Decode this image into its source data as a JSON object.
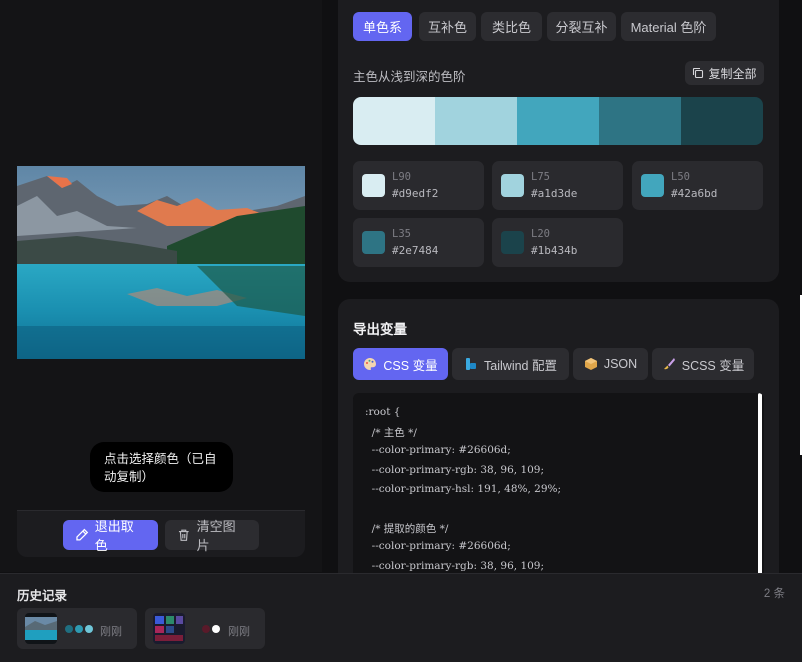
{
  "scheme_tabs": [
    {
      "label": "单色系",
      "active": true
    },
    {
      "label": "互补色",
      "active": false
    },
    {
      "label": "类比色",
      "active": false
    },
    {
      "label": "分裂互补",
      "active": false
    },
    {
      "label": "Material 色阶",
      "active": false
    }
  ],
  "scale_section": {
    "label": "主色从浅到深的色阶",
    "copy_all_label": "复制全部",
    "swatches": [
      {
        "level": "L90",
        "hex": "#d9edf2"
      },
      {
        "level": "L75",
        "hex": "#a1d3de"
      },
      {
        "level": "L50",
        "hex": "#42a6bd"
      },
      {
        "level": "L35",
        "hex": "#2e7484"
      },
      {
        "level": "L20",
        "hex": "#1b434b"
      }
    ]
  },
  "export": {
    "title": "导出变量",
    "tabs": [
      {
        "label": "CSS 变量",
        "icon": "palette-icon",
        "active": true
      },
      {
        "label": "Tailwind 配置",
        "icon": "tailwind-icon",
        "active": false
      },
      {
        "label": "JSON",
        "icon": "box-icon",
        "active": false
      },
      {
        "label": "SCSS 变量",
        "icon": "brush-icon",
        "active": false
      }
    ],
    "code_lines": [
      ":root {",
      "  /* 主色 */",
      "  --color-primary: #26606d;",
      "  --color-primary-rgb: 38, 96, 109;",
      "  --color-primary-hsl: 191, 48%, 29%;",
      "",
      "  /* 提取的颜色 */",
      "  --color-primary: #26606d;",
      "  --color-primary-rgb: 38, 96, 109;"
    ]
  },
  "picker": {
    "tooltip": "点击选择颜色（已自动复制）",
    "exit_button": "退出取色",
    "clear_button": "清空图片"
  },
  "history": {
    "title": "历史记录",
    "count": "2 条",
    "items": [
      {
        "time": "刚刚",
        "dots": [
          "#1f6e80",
          "#2e9ab2",
          "#6fc6d8"
        ]
      },
      {
        "time": "刚刚",
        "dots": [
          "#5a1a2a",
          "#ffffff"
        ]
      }
    ]
  },
  "colors": {
    "accent": "#6366f1",
    "panel": "#1c1c1f",
    "background": "#101012"
  }
}
